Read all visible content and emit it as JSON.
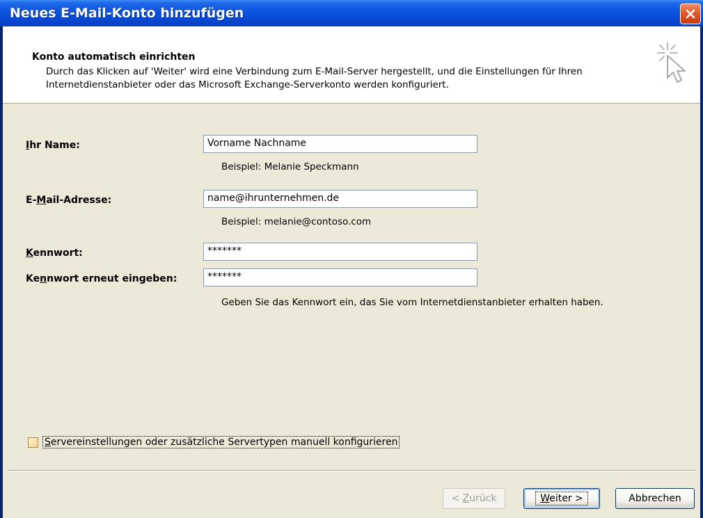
{
  "window": {
    "title": "Neues E-Mail-Konto hinzufügen",
    "close_icon": "close-icon"
  },
  "header": {
    "title": "Konto automatisch einrichten",
    "description": "Durch das Klicken auf 'Weiter' wird eine Verbindung zum E-Mail-Server hergestellt, und die Einstellungen für Ihren Internetdienstanbieter oder das Microsoft Exchange-Serverkonto werden konfiguriert.",
    "icon": "cursor-sparkle-icon"
  },
  "form": {
    "name": {
      "label_pre": "",
      "label_key": "I",
      "label_post": "hr Name:",
      "value": "Vorname Nachname",
      "hint": "Beispiel: Melanie Speckmann"
    },
    "email": {
      "label_pre": "E-",
      "label_key": "M",
      "label_post": "ail-Adresse:",
      "value": "name@ihrunternehmen.de",
      "hint": "Beispiel: melanie@contoso.com"
    },
    "password": {
      "label_pre": "",
      "label_key": "K",
      "label_post": "ennwort:",
      "value": "*******"
    },
    "password_confirm": {
      "label_pre": "Ke",
      "label_key": "n",
      "label_post": "nwort erneut eingeben:",
      "value": "*******",
      "hint": "Geben Sie das Kennwort ein, das Sie vom Internetdienstanbieter erhalten haben."
    }
  },
  "manual_config": {
    "label_key": "S",
    "label_post": "ervereinstellungen oder zusätzliche Servertypen manuell konfigurieren",
    "checked": false
  },
  "buttons": {
    "back": {
      "pre": "< ",
      "key": "Z",
      "post": "urück"
    },
    "next": {
      "pre": "",
      "key": "W",
      "post": "eiter >"
    },
    "cancel": {
      "label": "Abbrechen"
    }
  },
  "colors": {
    "titlebar": "#0a54e0",
    "dialog_bg": "#ece9d8",
    "close_button": "#e05a2a"
  }
}
